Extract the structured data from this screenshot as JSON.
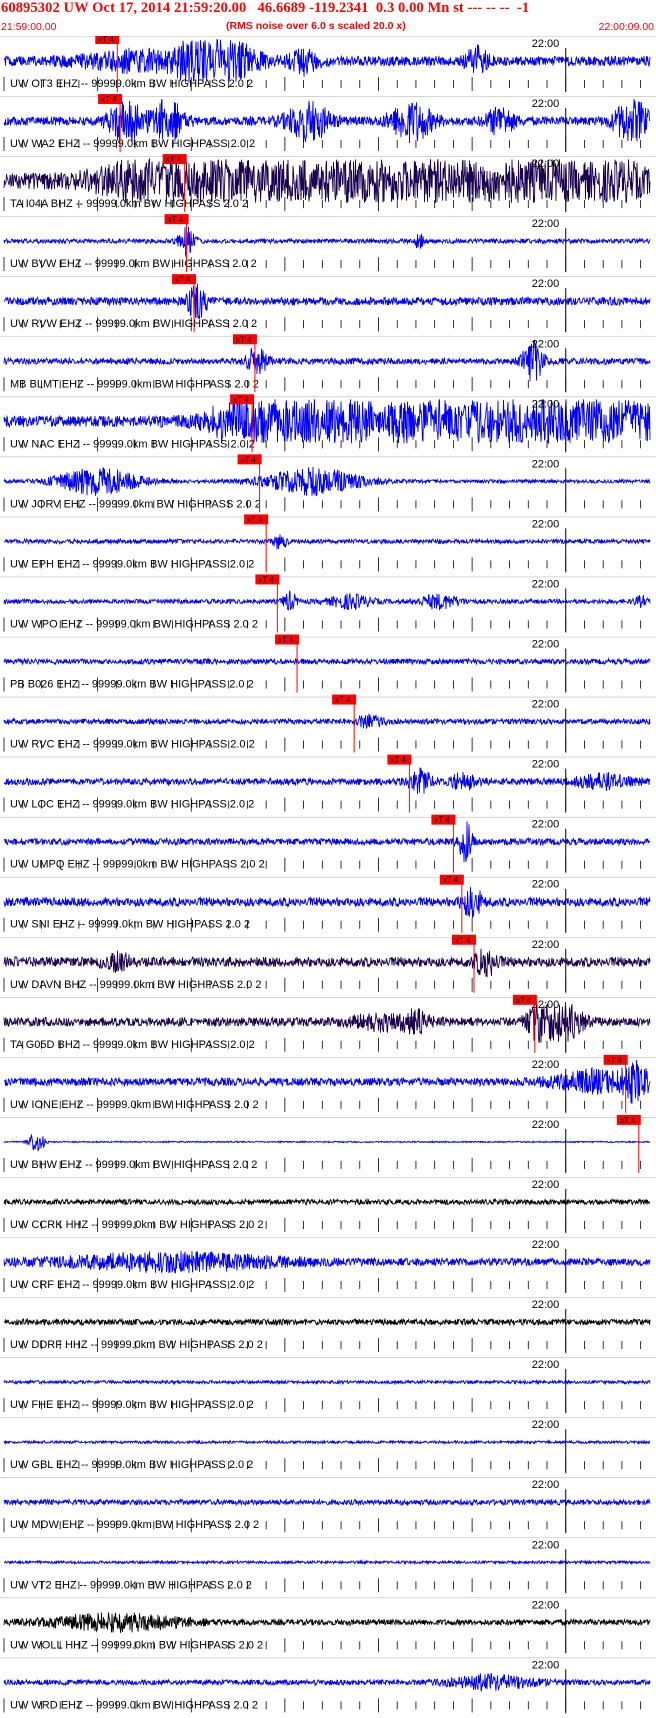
{
  "header": {
    "title": "60895302 UW Oct 17, 2014 21:59:20.00   46.6689 -119.2341  0.3 0.00 Mn st --- -- --  -1",
    "subtitle": "(RMS noise over 6.0 s scaled 20.0 x)",
    "time_start": "21:59:00.00",
    "time_end": "22:00:09.00"
  },
  "colors": {
    "header_text": "#ff0000",
    "trace_blue": "#0000ff",
    "trace_dark": "#1a0050",
    "trace_black": "#000000",
    "pick_box": "#ff0000",
    "pick_line": "#ff0000",
    "tick": "#000000"
  },
  "chart_data": {
    "type": "line",
    "x_axis": {
      "start": "21:59:00.00",
      "end": "22:00:09.00",
      "minute_label": "22:00",
      "minute_tick_seconds": 60,
      "tick_interval_seconds": 2
    },
    "pick_label": "xT 4",
    "channel_tail": "-- 99999.0km BW  HIGHPASS  2.0  2",
    "series": [
      {
        "name": "UW OT3 EHZ",
        "color": "blue",
        "pick_s": 12.1,
        "bursts": [
          {
            "t": 21,
            "a": 0.95,
            "w": 1.5
          },
          {
            "t": 23.5,
            "a": 0.9,
            "w": 2.5
          },
          {
            "t": 32,
            "a": 0.5,
            "w": 1
          },
          {
            "t": 50.5,
            "a": 0.55,
            "w": 0.8
          },
          {
            "t": 14,
            "a": 0.4,
            "w": 4
          }
        ],
        "noise": 0.22
      },
      {
        "name": "UW WA2 EHZ",
        "color": "blue",
        "pick_s": 12.4,
        "bursts": [
          {
            "t": 13,
            "a": 1.0,
            "w": 1.2
          },
          {
            "t": 17.5,
            "a": 0.9,
            "w": 1.2
          },
          {
            "t": 32.5,
            "a": 0.9,
            "w": 1.5
          },
          {
            "t": 43.5,
            "a": 0.9,
            "w": 1.5
          },
          {
            "t": 53,
            "a": 0.6,
            "w": 1
          },
          {
            "t": 67,
            "a": 1.0,
            "w": 1.2
          }
        ],
        "noise": 0.2
      },
      {
        "name": "TA I04A BHZ",
        "color": "dark",
        "pick_s": 19.3,
        "bursts": [
          {
            "t": 18,
            "a": 0.9,
            "w": 5
          },
          {
            "t": 30,
            "a": 0.8,
            "w": 9
          },
          {
            "t": 45,
            "a": 0.75,
            "w": 6
          },
          {
            "t": 57,
            "a": 0.7,
            "w": 5
          },
          {
            "t": 66,
            "a": 0.6,
            "w": 2
          }
        ],
        "noise": 0.35
      },
      {
        "name": "UW BVW EHZ",
        "color": "blue",
        "pick_s": 19.5,
        "bursts": [
          {
            "t": 19.5,
            "a": 0.6,
            "w": 0.6
          },
          {
            "t": 44.3,
            "a": 0.4,
            "w": 0.3
          }
        ],
        "noise": 0.1
      },
      {
        "name": "UW RVW EHZ",
        "color": "blue",
        "pick_s": 20.3,
        "bursts": [
          {
            "t": 20.6,
            "a": 0.7,
            "w": 0.8
          }
        ],
        "noise": 0.18
      },
      {
        "name": "MB BLMT EHZ",
        "color": "blue",
        "pick_s": 26.8,
        "bursts": [
          {
            "t": 27,
            "a": 0.6,
            "w": 0.8
          },
          {
            "t": 56.5,
            "a": 0.85,
            "w": 0.8
          }
        ],
        "noise": 0.14
      },
      {
        "name": "UW NAC EHZ",
        "color": "blue",
        "pick_s": 26.5,
        "bursts": [
          {
            "t": 24,
            "a": 0.5,
            "w": 1.5
          },
          {
            "t": 30,
            "a": 0.95,
            "w": 4
          },
          {
            "t": 40,
            "a": 0.9,
            "w": 8
          },
          {
            "t": 55,
            "a": 0.9,
            "w": 8
          },
          {
            "t": 65,
            "a": 0.85,
            "w": 4
          }
        ],
        "noise": 0.25
      },
      {
        "name": "UW JORV EHZ",
        "color": "blue",
        "pick_s": 27.3,
        "bursts": [
          {
            "t": 10,
            "a": 0.6,
            "w": 3
          },
          {
            "t": 33,
            "a": 0.6,
            "w": 3.5
          }
        ],
        "noise": 0.08
      },
      {
        "name": "UW EPH EHZ",
        "color": "blue",
        "pick_s": 28.0,
        "bursts": [
          {
            "t": 29.5,
            "a": 0.35,
            "w": 0.5
          }
        ],
        "noise": 0.1
      },
      {
        "name": "UW WPO EHZ",
        "color": "blue",
        "pick_s": 29.2,
        "bursts": [
          {
            "t": 30.5,
            "a": 0.4,
            "w": 0.5
          },
          {
            "t": 37,
            "a": 0.3,
            "w": 1.5
          },
          {
            "t": 46.5,
            "a": 0.3,
            "w": 1.5
          },
          {
            "t": 68,
            "a": 0.2,
            "w": 0.5
          }
        ],
        "noise": 0.1
      },
      {
        "name": "PB B026 EHZ",
        "color": "blue",
        "pick_s": 31.3,
        "bursts": [],
        "noise": 0.12
      },
      {
        "name": "UW RVC EHZ",
        "color": "blue",
        "pick_s": 37.4,
        "bursts": [
          {
            "t": 39,
            "a": 0.25,
            "w": 1
          }
        ],
        "noise": 0.12
      },
      {
        "name": "UW LOC EHZ",
        "color": "blue",
        "pick_s": 43.3,
        "bursts": [
          {
            "t": 44.5,
            "a": 0.5,
            "w": 0.8
          },
          {
            "t": 49,
            "a": 0.3,
            "w": 1
          },
          {
            "t": 64,
            "a": 0.3,
            "w": 2
          }
        ],
        "noise": 0.15
      },
      {
        "name": "UW UMPQ EHZ",
        "color": "blue",
        "pick_s": 48.0,
        "bursts": [
          {
            "t": 49.3,
            "a": 0.9,
            "w": 0.5
          }
        ],
        "noise": 0.15
      },
      {
        "name": "UW SNI EHZ",
        "color": "blue",
        "pick_s": 48.9,
        "bursts": [
          {
            "t": 50,
            "a": 0.6,
            "w": 0.8
          }
        ],
        "noise": 0.2
      },
      {
        "name": "UW DAVN BHZ",
        "color": "dark",
        "pick_s": 50.2,
        "bursts": [
          {
            "t": 51.5,
            "a": 0.6,
            "w": 0.8
          },
          {
            "t": 12,
            "a": 0.35,
            "w": 1
          }
        ],
        "noise": 0.22
      },
      {
        "name": "TA G05D BHZ",
        "color": "dark",
        "pick_s": 56.7,
        "bursts": [
          {
            "t": 44,
            "a": 0.4,
            "w": 1
          },
          {
            "t": 57.5,
            "a": 0.9,
            "w": 1
          },
          {
            "t": 59.5,
            "a": 0.85,
            "w": 1.5
          },
          {
            "t": 40,
            "a": 0.3,
            "w": 2
          }
        ],
        "noise": 0.2
      },
      {
        "name": "UW IONE EHZ",
        "color": "blue",
        "pick_s": 66.4,
        "bursts": [
          {
            "t": 63,
            "a": 0.45,
            "w": 3
          },
          {
            "t": 67.5,
            "a": 0.7,
            "w": 1
          }
        ],
        "noise": 0.18
      },
      {
        "name": "UW BHW EHZ",
        "color": "blue",
        "pick_s": 67.8,
        "bursts": [
          {
            "t": 3.5,
            "a": 0.45,
            "w": 0.6
          }
        ],
        "noise": 0.03
      },
      {
        "name": "UW CCRK HHZ",
        "color": "black",
        "pick_s": null,
        "bursts": [],
        "noise": 0.12
      },
      {
        "name": "UW CRF EHZ",
        "color": "blue",
        "pick_s": null,
        "bursts": [
          {
            "t": 18,
            "a": 0.35,
            "w": 8
          }
        ],
        "noise": 0.17
      },
      {
        "name": "UW DDRF HHZ",
        "color": "black",
        "pick_s": null,
        "bursts": [],
        "noise": 0.13
      },
      {
        "name": "UW FHE EHZ",
        "color": "blue",
        "pick_s": null,
        "bursts": [],
        "noise": 0.07
      },
      {
        "name": "UW GBL EHZ",
        "color": "blue",
        "pick_s": null,
        "bursts": [],
        "noise": 0.06
      },
      {
        "name": "UW MDW EHZ",
        "color": "blue",
        "pick_s": null,
        "bursts": [],
        "noise": 0.12
      },
      {
        "name": "UW VT2 EHZ",
        "color": "blue",
        "pick_s": null,
        "bursts": [],
        "noise": 0.06
      },
      {
        "name": "UW WOLL HHZ",
        "color": "black",
        "pick_s": null,
        "bursts": [
          {
            "t": 12,
            "a": 0.35,
            "w": 5
          }
        ],
        "noise": 0.13
      },
      {
        "name": "UW WRD EHZ",
        "color": "blue",
        "pick_s": null,
        "bursts": [
          {
            "t": 52,
            "a": 0.3,
            "w": 3
          }
        ],
        "noise": 0.12
      }
    ]
  }
}
